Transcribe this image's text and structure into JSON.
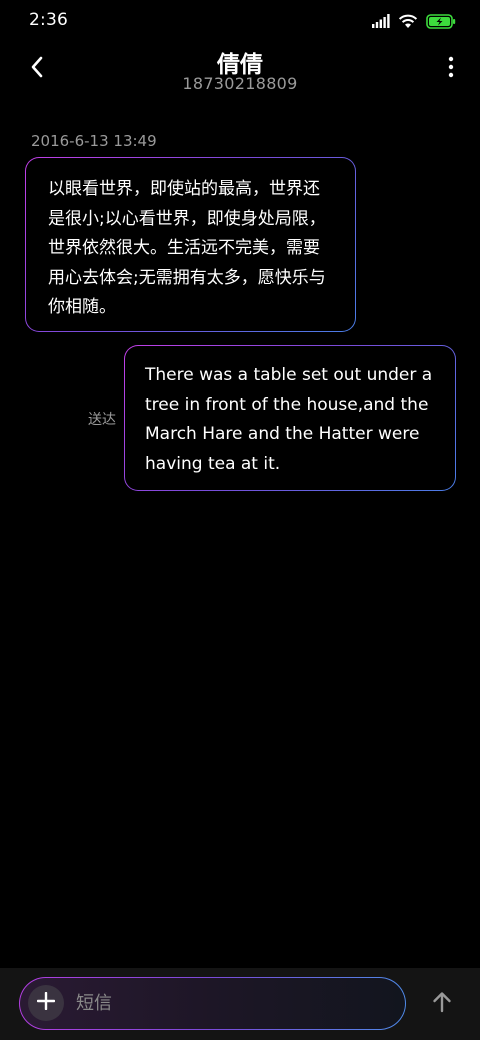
{
  "status_bar": {
    "time": "2:36",
    "icons": [
      "signal-icon",
      "wifi-icon",
      "battery-charging-icon"
    ],
    "battery_color": "#3ddc3d"
  },
  "header": {
    "contact_name": "倩倩",
    "contact_number": "18730218809",
    "back_icon": "chevron-left-icon",
    "more_icon": "more-vertical-icon"
  },
  "conversation": {
    "timestamp": "2016-6-13 13:49",
    "messages": [
      {
        "direction": "incoming",
        "text": "以眼看世界，即使站的最高，世界还是很小;以心看世界，即使身处局限，世界依然很大。生活远不完美，需要用心去体会;无需拥有太多，愿快乐与你相随。"
      },
      {
        "direction": "outgoing",
        "text": "There was a table set out under a tree in front of the house,and the March Hare and the Hatter were having tea at it.",
        "status": "送达"
      }
    ]
  },
  "composer": {
    "placeholder": "短信",
    "value": "",
    "add_icon": "plus-icon",
    "send_icon": "arrow-up-icon"
  },
  "colors": {
    "background": "#000000",
    "bubble_border_start": "#c23fe8",
    "bubble_border_end": "#4a7de6",
    "secondary_text": "#9a9a9a"
  }
}
